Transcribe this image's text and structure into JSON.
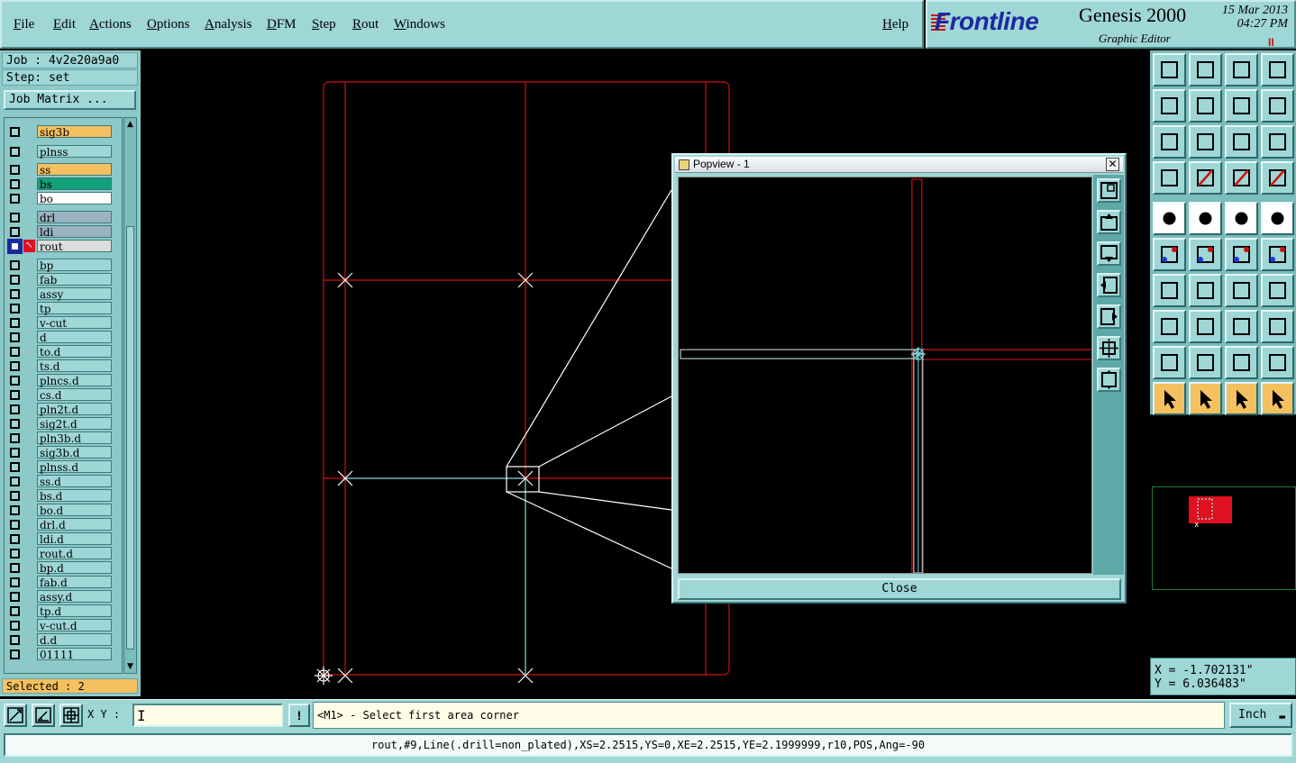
{
  "menubar": {
    "items": [
      "File",
      "Edit",
      "Actions",
      "Options",
      "Analysis",
      "DFM",
      "Step",
      "Rout",
      "Windows"
    ],
    "help": "Help"
  },
  "brand": {
    "logo": "Frontline",
    "product": "Genesis 2000",
    "subtitle": "Graphic Editor",
    "date": "15 Mar 2013",
    "time": "04:27 PM",
    "indicator": "II"
  },
  "left_panel": {
    "job": "Job : 4v2e20a9a0",
    "step": "Step: set",
    "job_matrix_button": "Job Matrix ...",
    "layers": [
      {
        "name": "sig3b",
        "color": "#f5c060"
      },
      {
        "name": "plnss",
        "color": "#9fd6d6"
      },
      {
        "name": "ss",
        "color": "#f5c060"
      },
      {
        "name": "bs",
        "color": "#12a07a"
      },
      {
        "name": "bo",
        "color": "#ffffff"
      },
      {
        "name": "drl",
        "color": "#9ab3c0"
      },
      {
        "name": "ldi",
        "color": "#9ab3c0"
      },
      {
        "name": "rout",
        "color": "#dcdcdc",
        "active": true
      },
      {
        "name": "bp",
        "color": "#9fd6d6"
      },
      {
        "name": "fab",
        "color": "#9fd6d6"
      },
      {
        "name": "assy",
        "color": "#9fd6d6"
      },
      {
        "name": "tp",
        "color": "#9fd6d6"
      },
      {
        "name": "v-cut",
        "color": "#9fd6d6"
      },
      {
        "name": "d",
        "color": "#9fd6d6"
      },
      {
        "name": "to.d",
        "color": "#9fd6d6"
      },
      {
        "name": "ts.d",
        "color": "#9fd6d6"
      },
      {
        "name": "plncs.d",
        "color": "#9fd6d6"
      },
      {
        "name": "cs.d",
        "color": "#9fd6d6"
      },
      {
        "name": "pln2t.d",
        "color": "#9fd6d6"
      },
      {
        "name": "sig2t.d",
        "color": "#9fd6d6"
      },
      {
        "name": "pln3b.d",
        "color": "#9fd6d6"
      },
      {
        "name": "sig3b.d",
        "color": "#9fd6d6"
      },
      {
        "name": "plnss.d",
        "color": "#9fd6d6"
      },
      {
        "name": "ss.d",
        "color": "#9fd6d6"
      },
      {
        "name": "bs.d",
        "color": "#9fd6d6"
      },
      {
        "name": "bo.d",
        "color": "#9fd6d6"
      },
      {
        "name": "drl.d",
        "color": "#9fd6d6"
      },
      {
        "name": "ldi.d",
        "color": "#9fd6d6"
      },
      {
        "name": "rout.d",
        "color": "#9fd6d6"
      },
      {
        "name": "bp.d",
        "color": "#9fd6d6"
      },
      {
        "name": "fab.d",
        "color": "#9fd6d6"
      },
      {
        "name": "assy.d",
        "color": "#9fd6d6"
      },
      {
        "name": "tp.d",
        "color": "#9fd6d6"
      },
      {
        "name": "v-cut.d",
        "color": "#9fd6d6"
      },
      {
        "name": "d.d",
        "color": "#9fd6d6"
      },
      {
        "name": "01111",
        "color": "#9fd6d6"
      }
    ],
    "selected": "Selected : 2"
  },
  "popview": {
    "title": "Popview - 1",
    "close_button": "Close",
    "tool_icons": [
      "zoom-window-icon",
      "pan-up-icon",
      "pan-down-icon",
      "pan-left-icon",
      "pan-right-icon",
      "zoom-home-icon",
      "zoom-fit-icon"
    ]
  },
  "right_panel": {
    "coord_x": "X = -1.702131\"",
    "coord_y": "Y = 6.036483\""
  },
  "command_bar": {
    "xy_label": "X Y :",
    "xy_value": "",
    "warning": "!",
    "prompt": "<M1> - Select first area corner",
    "units": "Inch",
    "units_arrow": "▬"
  },
  "status": "rout,#9,Line(.drill=non_plated),XS=2.2515,YS=0,XE=2.2515,YE=2.1999999,r10,POS,Ang=-90",
  "colors": {
    "panel": "#9fd6d6",
    "highlight": "#f5c060",
    "profile_line": "#d01010",
    "rout_line": "#6fd6d6"
  }
}
